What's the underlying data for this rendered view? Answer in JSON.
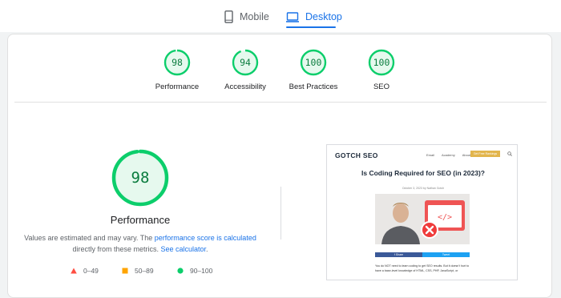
{
  "tabs": {
    "mobile": {
      "label": "Mobile",
      "icon": "phone-icon"
    },
    "desktop": {
      "label": "Desktop",
      "icon": "monitor-icon",
      "active": true
    }
  },
  "categories": [
    {
      "label": "Performance",
      "score": "98",
      "value": 98
    },
    {
      "label": "Accessibility",
      "score": "94",
      "value": 94
    },
    {
      "label": "Best Practices",
      "score": "100",
      "value": 100
    },
    {
      "label": "SEO",
      "score": "100",
      "value": 100
    }
  ],
  "performance": {
    "score": "98",
    "value": 98,
    "title": "Performance",
    "desc_prefix": "Values are estimated and may vary. The ",
    "desc_link1": "performance score is calculated",
    "desc_mid": "directly from these metrics. ",
    "desc_link2": "See calculator",
    "desc_suffix": "."
  },
  "legend": [
    {
      "range": "0–49",
      "shape": "triangle",
      "color": "#ff4e42"
    },
    {
      "range": "50–89",
      "shape": "square",
      "color": "#ffa400"
    },
    {
      "range": "90–100",
      "shape": "circle",
      "color": "#0cce6b"
    }
  ],
  "colors": {
    "pass": "#0cce6b",
    "pass_text": "#0a7c3e",
    "pass_bg": "#e6f9ee",
    "accent": "#1a73e8"
  },
  "screenshot": {
    "logo": "GOTCH SEO",
    "nav": [
      "Email",
      "Academy",
      "About"
    ],
    "cta": "Get Free Rankings",
    "post_title": "Is Coding Required for SEO (in 2023)?",
    "post_meta": "October 3, 2023 by Nathan Gotch",
    "share_fb": "f Share",
    "share_tw": "Tweet",
    "body": "You do NOT need to learn coding to get SEO results. But it doesn't hurt to have a base-level knowledge of HTML, CSS, PHP, JavaScript, or"
  }
}
